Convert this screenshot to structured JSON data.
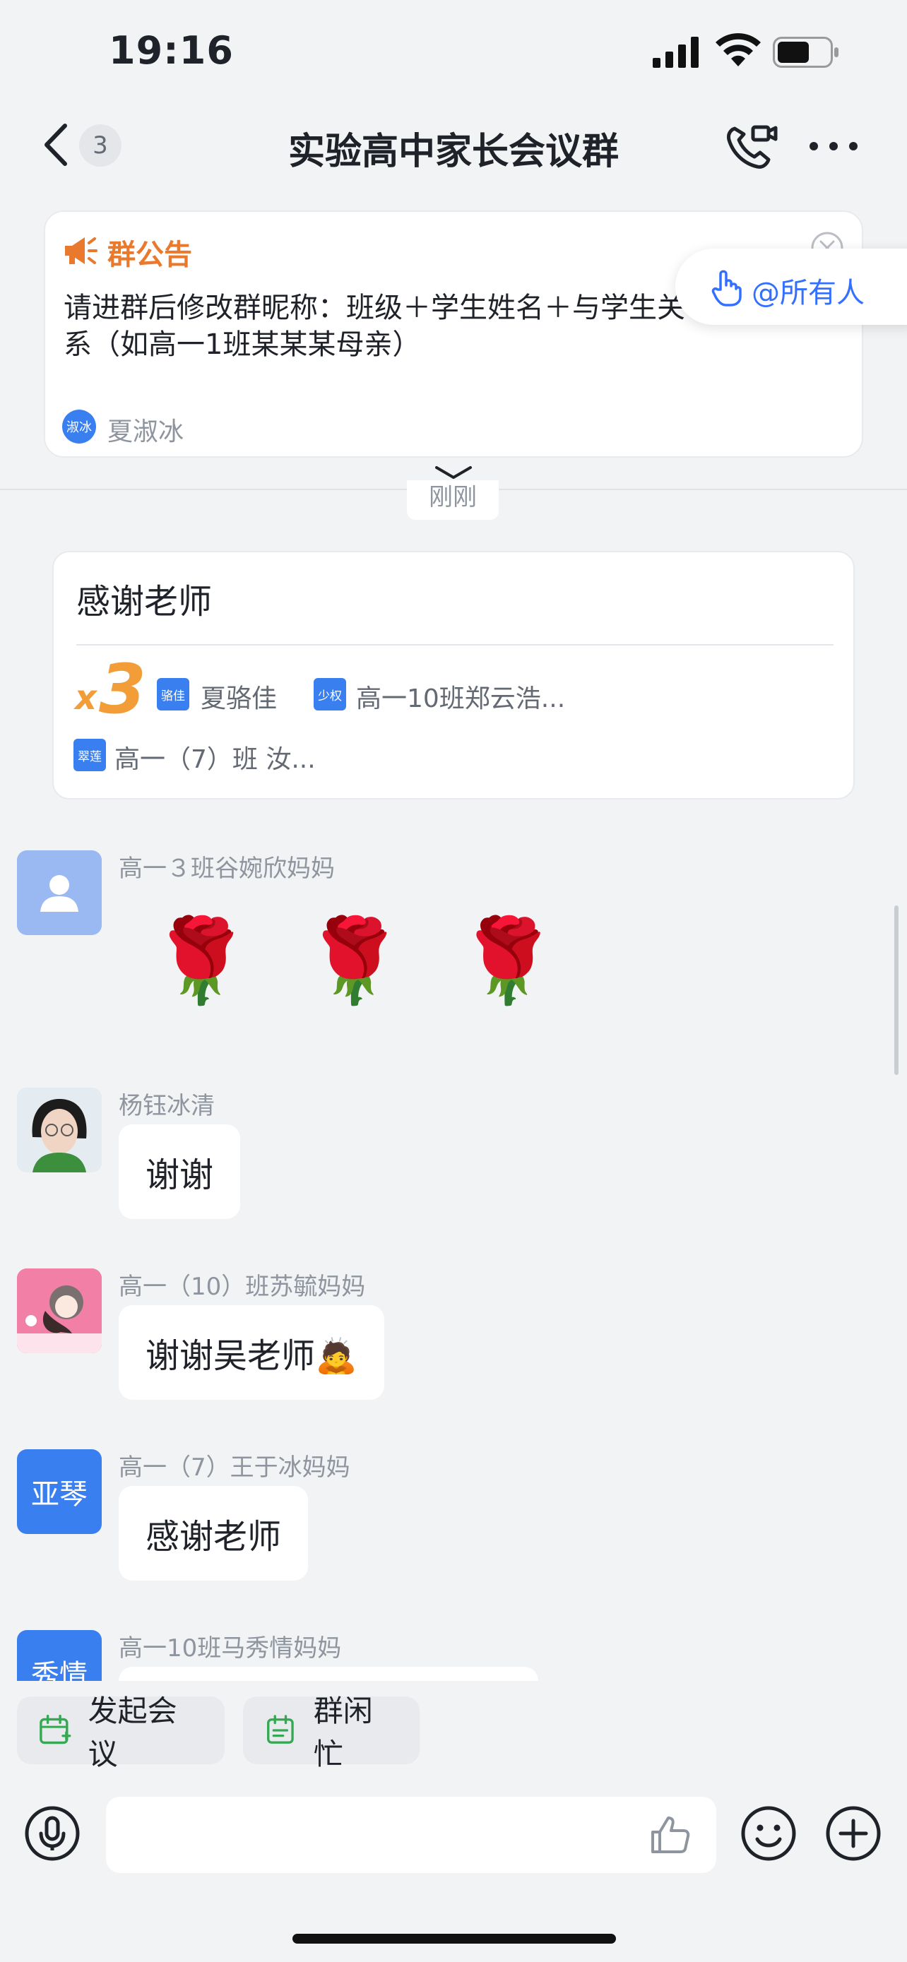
{
  "status_bar": {
    "time": "19:16"
  },
  "nav": {
    "unread_count": "3",
    "title": "实验高中家长会议群"
  },
  "announcement": {
    "label": "群公告",
    "body": "请进群后修改群昵称：班级＋学生姓名＋与学生关\n系（如高一1班某某某母亲）",
    "author_avatar_text": "淑冰",
    "author_name": "夏淑冰",
    "mention_all": "@所有人"
  },
  "time_divider": "刚刚",
  "reaction_card": {
    "message": "感谢老师",
    "multiplier_x": "x",
    "multiplier_n": "3",
    "reactors": [
      {
        "avatar_text": "骆佳",
        "name": "夏骆佳"
      },
      {
        "avatar_text": "少权",
        "name": "高一10班郑云浩..."
      },
      {
        "avatar_text": "翠莲",
        "name": "高一（7）班 汝..."
      }
    ]
  },
  "messages": [
    {
      "sender": "高一３班谷婉欣妈妈",
      "content": "🌹 🌹 🌹",
      "type": "emoji"
    },
    {
      "sender": "杨钰冰清",
      "content": "谢谢",
      "type": "text"
    },
    {
      "sender": "高一（10）班苏毓妈妈",
      "content": "谢谢吴老师🙇",
      "type": "text"
    },
    {
      "sender": "高一（7）王于冰妈妈",
      "avatar_text": "亚琴",
      "content": "感谢老师",
      "type": "text"
    },
    {
      "sender": "高一10班马秀情妈妈",
      "avatar_text": "秀情",
      "type": "text"
    }
  ],
  "quick_actions": [
    {
      "label": "发起会议",
      "icon": "calendar-add-icon"
    },
    {
      "label": "群闲忙",
      "icon": "calendar-list-icon"
    }
  ],
  "colors": {
    "accent_blue": "#3370ff",
    "avatar_blue": "#3a7ff0",
    "announcement_orange": "#e8792d",
    "reaction_orange": "#f29d38",
    "background": "#f2f3f5"
  }
}
